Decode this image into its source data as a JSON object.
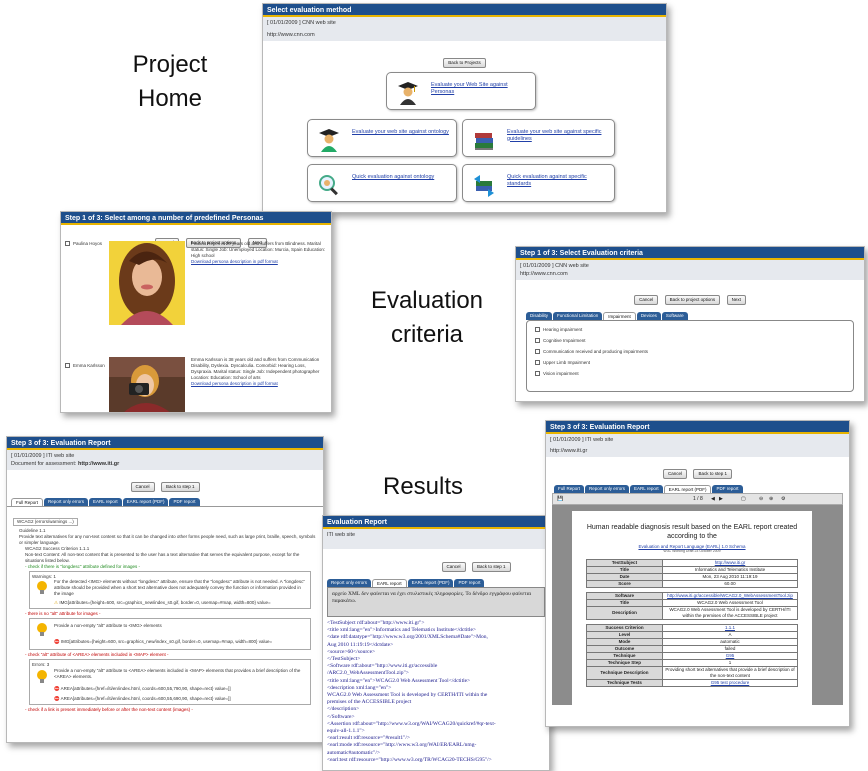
{
  "labels": {
    "project_home_1": "Project",
    "project_home_2": "Home",
    "eval_criteria_1": "Evaluation",
    "eval_criteria_2": "criteria",
    "results": "Results"
  },
  "project_home": {
    "title": "Select evaluation method",
    "project": "[ 01/01/2009 ] CNN web site",
    "url": "http://www.cnn.com",
    "back_button": "Back to Projects",
    "options": [
      {
        "label": "Evaluate your Web Site against Personas",
        "icon": "graduate-persona-icon"
      },
      {
        "label": "Evaluate your web site against ontology",
        "icon": "graduate-ontology-icon"
      },
      {
        "label": "Evaluate your web site against specific guidelines",
        "icon": "books-icon"
      },
      {
        "label": "Quick evaluation against ontology",
        "icon": "magnifier-icon"
      },
      {
        "label": "Quick evaluation against specific standards",
        "icon": "books-arrows-icon"
      }
    ]
  },
  "personas": {
    "title": "Step 1 of 3: Select among a number of predefined Personas",
    "buttons": [
      "Cancel",
      "Back to project options",
      "Next"
    ],
    "items": [
      {
        "name": "Paulina Hoyos",
        "description": "Paulina Reyes is 20 years old and suffers from Blindness. Marital status: Single Job: Unemployed Location: Murcia, Spain Education: High school",
        "link": "Download persona description in pdf format"
      },
      {
        "name": "Emma Karlsson",
        "description": "Emma Karlsson is 38 years old and suffers from Communication Disability, Dyslexia. Dyscalculia. Comorbid: Hearing Loss, Dyspraxia. Marital status: Single Job: Independent photographer Location: Education: School of arts",
        "link": "Download persona description in pdf format"
      }
    ]
  },
  "criteria": {
    "title": "Step 1 of 3: Select Evaluation criteria",
    "project": "[ 01/01/2009 ] CNN web site",
    "url": "http://www.cnn.com",
    "buttons": [
      "Cancel",
      "Back to project options",
      "Next"
    ],
    "tabs": [
      "Disability",
      "Functional Limitation",
      "Impairment",
      "Devices",
      "Software"
    ],
    "active_tab": "Impairment",
    "items": [
      "Hearing impairment",
      "Cognitive Impairment",
      "Communication received and producing impairments",
      "Upper Limb Impairment",
      "Vision impairment"
    ]
  },
  "report_left": {
    "title": "Step 3 of 3: Evaluation Report",
    "project": "[ 01/01/2009 ] ITI web site",
    "document_label": "Document for assessment:",
    "document_url": "http://www.iti.gr",
    "buttons": [
      "Cancel",
      "Back to step 1"
    ],
    "tabs": [
      "Full Report",
      "Report only errors",
      "EARL report",
      "EARL report (PDF)",
      "PDF report"
    ],
    "active_tab": "Full Report",
    "lines": {
      "summary": "WCAG2 (errors/warnings ...)",
      "guideline": "Guideline 1.1",
      "guideline_text": "Provide text alternatives for any non-text content so that it can be changed into other forms people need, such as large print, braille, speech, symbols or simpler language.",
      "sc": "WCAG2 Success Criterion 1.1.1",
      "sc_text": "Non-text Content: All non-text content that is presented to the user has a text alternative that serves the equivalent purpose, except for the situations listed below.",
      "check1": "- check if there is \"longdesc\" attribute defined for images -",
      "warnings": "Warnings: 1",
      "warn_text": "For the detected <IMG> elements without \"longdesc\" attribute, ensure that the \"longdesc\" attribute is not needed. A \"longdesc\" attribute should be provided when a short text alternative does not adequately convey the function or information provided in the image",
      "warn_item": "IMG[attributes={height=600, src=graphics_new/index_s0.gif, border=0, usemap=#map, width=800} value=",
      "check2": "- there is no \"alt\" attribute for images -",
      "err_text1": "Provide a non-empty \"alt\" attribute to <IMG> elements",
      "err_item1": "IMG[attributes={height=600, src=graphics_new/index_s0.gif, border=0, usemap=#map, width=800} value=",
      "check3": "- check \"alt\" attribute of <AREA> elements included in <MAP> element -",
      "errors": "Errors: 3",
      "err_text2": "Provide a non-empty \"alt\" attribute to <AREA> elements included in <MAP> elements that provides a brief description of the <AREA> elements.",
      "err_item2": "AREA[attributes={href=/iti/en/index.html, coords=600,55,790,90, shape=rect} value=]]",
      "err_item3": "AREA[attributes={href=/iti/en/index.html, coords=600,55,690,90, shape=rect} value=]]",
      "check4": "- check if a link is present immediately before or after the non-text content (images) -"
    }
  },
  "report_middle": {
    "title": "Evaluation Report",
    "project": "ITI web site",
    "buttons": [
      "Cancel",
      "Back to step 1"
    ],
    "tabs": [
      "Report only errors",
      "EARL report",
      "EARL report (PDF)",
      "PDF report"
    ],
    "active_tab": "EARL report",
    "greek": "αρχείο XML δεν φαίνεται να έχει στυλιστικές πληροφορίες. Το δένδρο εγγράφου φαίνεται παρακάτω.",
    "code_lines": [
      "<TestSubject rdf:about=\"http://www.iti.gr\">",
      "<title xml:lang=\"en\">Informatics and Telematics Institute</dctitle>",
      "<date rdf:datatype=\"http://www.w3.org/2001/XMLSchema#Date\">Mon,",
      "Aug 2010 11:19:19</dctdate>",
      "<source>60</source>",
      "</TestSubject>",
      "<Software rdf:about=\"http://www.iti.gr/accessible",
      "/ARC2.0_WebAssessmentTool.zip\">",
      "<title xml:lang=\"en\">WCAG2.0 Web Assessment Tool</dctitle>",
      "<description xml:lang=\"en\">",
      "WCAG2.0 Web Assessment Tool is developed by CERTH/ITI within the",
      "premises of the ACCESSIBLE project",
      "</description>",
      "</Software>",
      "<Assertion rdf:about=\"http://www.w3.org/WAI/WCAG20/quickref/#qr-text-",
      "equiv-all-1.1.1\">",
      "<earl:result rdf:resource=\"#result1\"/>",
      "<earl:mode rdf:resource=\"http://www.w3.org/WAI/ER/EARL/nmg-",
      "automatic#automatic\"/>",
      "<earl:test rdf:resource=\"http://www.w3.org/TR/WCAG20-TECHS/G95\"/>"
    ]
  },
  "report_right": {
    "title": "Step 3 of 3: Evaluation Report",
    "project": "[ 01/01/2009 ] ITI web site",
    "url": "http://www.iti.gr",
    "buttons": [
      "Cancel",
      "Back to step 1"
    ],
    "tabs": [
      "Full Report",
      "Report only errors",
      "EARL report",
      "EARL report (PDF)",
      "PDF report"
    ],
    "active_tab": "EARL report (PDF)",
    "toolbar_page": "1 / 8",
    "doc_heading": "Human readable diagnosis result based on the EARL report created according to the",
    "doc_link": "Evaluation and Report Language (EARL) 1.0 Schema",
    "doc_small": "W3C Working Draft 23 October 2009",
    "table1": [
      {
        "k": "TestSubject",
        "v": "http://www.iti.gr"
      },
      {
        "k": "Title",
        "v": "Informatics and Telematics Institute"
      },
      {
        "k": "Date",
        "v": "Mon, 23 Aug 2010 11:19:19"
      },
      {
        "k": "Score",
        "v": "60.00"
      }
    ],
    "table2": [
      {
        "k": "Software",
        "v": "http://www.iti.gr/accessible/WCAG2.0_WebAssessmentTool.zip"
      },
      {
        "k": "Title",
        "v": "WCAG2.0 Web Assessment Tool"
      },
      {
        "k": "Description",
        "v": "WCAG2.0 Web Assessment Tool is developed by CERTH/ITI within the premises of the ACCESSIBLE project"
      }
    ],
    "table3": [
      {
        "k": "Success Criterion",
        "v": "1.1.1"
      },
      {
        "k": "Level",
        "v": "A"
      },
      {
        "k": "Mode",
        "v": "automatic"
      },
      {
        "k": "Outcome",
        "v": "failed"
      },
      {
        "k": "Technique",
        "v": "G95"
      },
      {
        "k": "Technique Step",
        "v": "1"
      },
      {
        "k": "Technique Description",
        "v": "Providing short text alternatives that provide a brief description of the non-text content"
      },
      {
        "k": "Technique Tests",
        "v": "G95 test procedure"
      }
    ]
  }
}
